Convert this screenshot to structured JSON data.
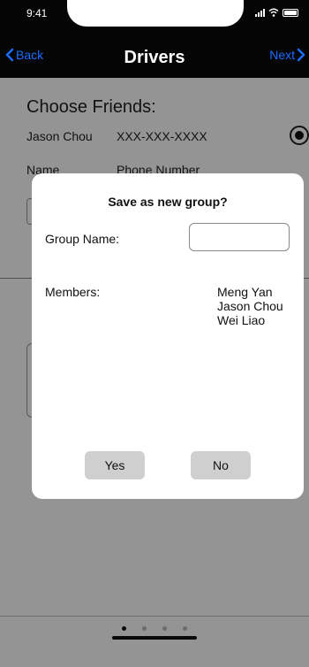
{
  "status_bar": {
    "time": "9:41"
  },
  "nav": {
    "back_label": "Back",
    "title": "Drivers",
    "next_label": "Next"
  },
  "background": {
    "section_title": "Choose Friends:",
    "friend": {
      "name": "Jason Chou",
      "phone": "XXX-XXX-XXXX"
    },
    "columns": {
      "name": "Name",
      "phone": "Phone Number"
    }
  },
  "modal": {
    "title": "Save as new group?",
    "group_name_label": "Group Name:",
    "group_name_value": "",
    "members_label": "Members:",
    "members": [
      "Meng Yan",
      "Jason Chou",
      "Wei Liao"
    ],
    "yes_label": "Yes",
    "no_label": "No"
  },
  "pagination": {
    "total": 4,
    "current": 1
  },
  "colors": {
    "accent": "#1a6dff",
    "header_bg": "#050505",
    "button_bg": "#cfcfcf"
  }
}
